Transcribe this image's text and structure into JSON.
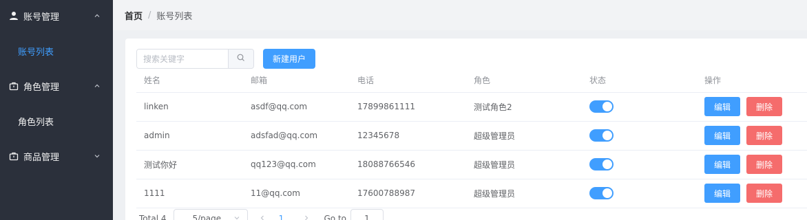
{
  "sidebar": {
    "groups": [
      {
        "label": "账号管理",
        "icon": "user-icon",
        "expanded": true,
        "items": [
          {
            "label": "账号列表",
            "active": true
          }
        ]
      },
      {
        "label": "角色管理",
        "icon": "briefcase-icon",
        "expanded": true,
        "items": [
          {
            "label": "角色列表",
            "active": false
          }
        ]
      },
      {
        "label": "商品管理",
        "icon": "briefcase-icon",
        "expanded": false,
        "items": []
      }
    ]
  },
  "breadcrumb": {
    "home": "首页",
    "separator": "/",
    "current": "账号列表"
  },
  "toolbar": {
    "search_placeholder": "搜索关键字",
    "new_user_label": "新建用户"
  },
  "table": {
    "columns": [
      "姓名",
      "邮箱",
      "电话",
      "角色",
      "状态",
      "操作"
    ],
    "rows": [
      {
        "name": "linken",
        "email": "asdf@qq.com",
        "phone": "17899861111",
        "role": "测试角色2",
        "status": true
      },
      {
        "name": "admin",
        "email": "adsfad@qq.com",
        "phone": "12345678",
        "role": "超级管理员",
        "status": true
      },
      {
        "name": "测试你好",
        "email": "qq123@qq.com",
        "phone": "18088766546",
        "role": "超级管理员",
        "status": true
      },
      {
        "name": "1111",
        "email": "11@qq.com",
        "phone": "17600788987",
        "role": "超级管理员",
        "status": true
      }
    ],
    "edit_label": "编辑",
    "delete_label": "删除"
  },
  "pagination": {
    "total_text": "Total 4",
    "page_size": "5/page",
    "current_page": "1",
    "goto_label": "Go to",
    "goto_value": "1"
  },
  "colors": {
    "sidebar_bg": "#2b303b",
    "accent": "#409eff",
    "danger": "#f56c6c"
  }
}
